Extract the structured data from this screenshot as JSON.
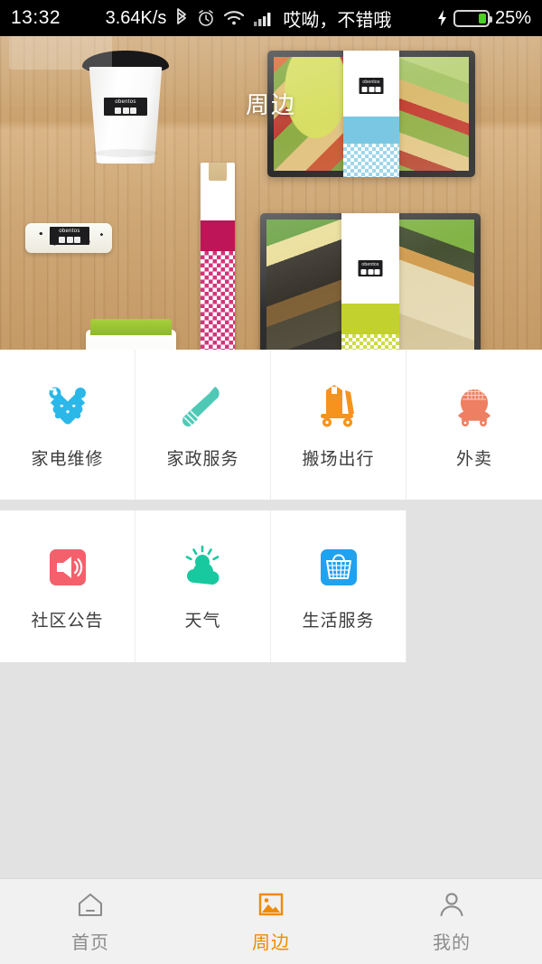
{
  "status_bar": {
    "time": "13:32",
    "network_speed": "3.64K/s",
    "carrier": "哎呦，不错哦",
    "battery_percent": "25%",
    "battery_level": 25,
    "icons": [
      "bluetooth-icon",
      "alarm-icon",
      "wifi-icon",
      "signal-icon",
      "charging-icon",
      "battery-icon"
    ]
  },
  "header": {
    "title": "周边"
  },
  "hero": {
    "brand": "obentos",
    "items": [
      "coffee-cup",
      "onigiri-roll",
      "chopstick-sleeve",
      "green-container",
      "bento-box-salad",
      "bento-box-rice"
    ]
  },
  "grid": {
    "row1": [
      {
        "label": "家电维修",
        "icon": "tools-icon",
        "color": "#2bb7e8"
      },
      {
        "label": "家政服务",
        "icon": "broom-icon",
        "color": "#4ec9b6"
      },
      {
        "label": "搬场出行",
        "icon": "hand-truck-icon",
        "color": "#f6931e"
      },
      {
        "label": "外卖",
        "icon": "takeout-bowl-icon",
        "color": "#ef7f62"
      }
    ],
    "row2": [
      {
        "label": "社区公告",
        "icon": "announcement-speaker-icon",
        "color": "#f4606c"
      },
      {
        "label": "天气",
        "icon": "sun-cloud-icon",
        "color": "#18c9a0"
      },
      {
        "label": "生活服务",
        "icon": "basket-icon",
        "color": "#1fa2f0"
      }
    ]
  },
  "tabbar": {
    "active_color": "#f08a00",
    "inactive_color": "#8c8c8c",
    "tabs": [
      {
        "label": "首页",
        "icon": "home-icon",
        "active": false
      },
      {
        "label": "周边",
        "icon": "image-icon",
        "active": true
      },
      {
        "label": "我的",
        "icon": "person-icon",
        "active": false
      }
    ]
  }
}
